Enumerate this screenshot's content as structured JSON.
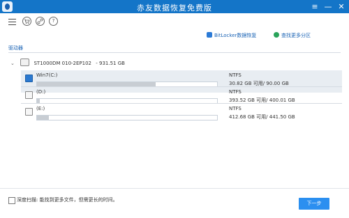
{
  "window": {
    "title": "赤友数据恢复免费版",
    "controls": {
      "menu": "≡",
      "minimize": "—",
      "close": "✕"
    }
  },
  "toolbar": {
    "icons": [
      "menu-icon",
      "cart-icon",
      "link-icon",
      "help-icon"
    ],
    "help_glyph": "?"
  },
  "actions": {
    "bitlocker": "BitLocker数据恢复",
    "find_more": "查找更多分区"
  },
  "section": {
    "label": "驱动器"
  },
  "disk": {
    "name": "ST1000DM  010-2EP102",
    "size": "- 931.51 GB"
  },
  "partitions": [
    {
      "name": "Win7(C:)",
      "fs": "NTFS",
      "capacity": "30.82 GB 可用/ 90.00 GB",
      "used_percent": 0.66,
      "selected": true
    },
    {
      "name": "(D:)",
      "fs": "NTFS",
      "capacity": "393.52 GB 可用/ 400.01 GB",
      "used_percent": 0.016,
      "selected": false
    },
    {
      "name": "(E:)",
      "fs": "NTFS",
      "capacity": "412.68 GB 可用/ 441.50 GB",
      "used_percent": 0.065,
      "selected": false
    }
  ],
  "footer": {
    "deep_scan_label": "深度扫描",
    "deep_scan_desc": ": 能找到更多文件，但需更长的时间。",
    "next_button": "下一步"
  },
  "colors": {
    "titlebar": "#1475c8",
    "accent": "#1a63b5",
    "button": "#2b8ff0"
  }
}
